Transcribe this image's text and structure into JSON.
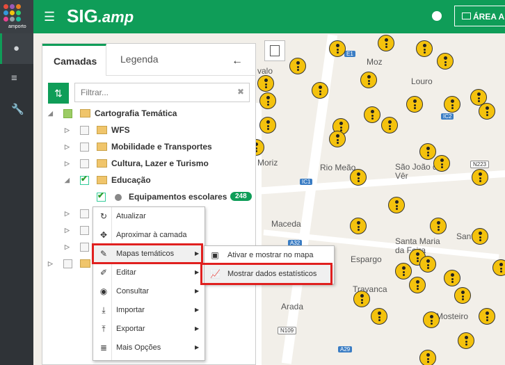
{
  "header": {
    "logo_text": "amporto",
    "brand_main": "SIG",
    "brand_suffix": ".amp",
    "area_label": "ÁREA A"
  },
  "sidenav": {
    "icons": [
      "globe-icon",
      "menu-list-icon",
      "wrench-icon"
    ]
  },
  "map": {
    "places": [
      "Moz",
      "Louro",
      "Rio Meão",
      "São João de Vêr",
      "Moriz",
      "Maceda",
      "Santa Maria da Feira",
      "Espargo",
      "Sanfins",
      "Travanca",
      "Arada",
      "Mosteiro",
      "valo"
    ],
    "road_labels": [
      "E1",
      "IC2",
      "N223",
      "IC1",
      "A32",
      "N109",
      "A29"
    ]
  },
  "panel": {
    "tabs": [
      "Camadas",
      "Legenda"
    ],
    "filter_placeholder": "Filtrar...",
    "tree": [
      {
        "label": "Cartografia Temática"
      },
      {
        "label": "WFS"
      },
      {
        "label": "Mobilidade e Transportes"
      },
      {
        "label": "Cultura, Lazer e Turismo"
      },
      {
        "label": "Educação"
      },
      {
        "label": "Equipamentos escolares",
        "count": "248"
      }
    ]
  },
  "context_menu": [
    {
      "label": "Atualizar",
      "icon": "refresh-icon"
    },
    {
      "label": "Aproximar à camada",
      "icon": "expand-icon"
    },
    {
      "label": "Mapas temáticos",
      "icon": "brush-icon"
    },
    {
      "label": "Editar",
      "icon": "edit-icon"
    },
    {
      "label": "Consultar",
      "icon": "eye-icon"
    },
    {
      "label": "Importar",
      "icon": "import-icon"
    },
    {
      "label": "Exportar",
      "icon": "export-icon"
    },
    {
      "label": "Mais Opções",
      "icon": "stack-icon"
    }
  ],
  "submenu": [
    {
      "label": "Ativar e mostrar no mapa",
      "icon": "map-show-icon"
    },
    {
      "label": "Mostrar dados estatísticos",
      "icon": "line-chart-icon"
    }
  ],
  "colors": {
    "accent": "#0f9d58",
    "highlight": "#e0201f",
    "marker": "#f4c20d"
  }
}
